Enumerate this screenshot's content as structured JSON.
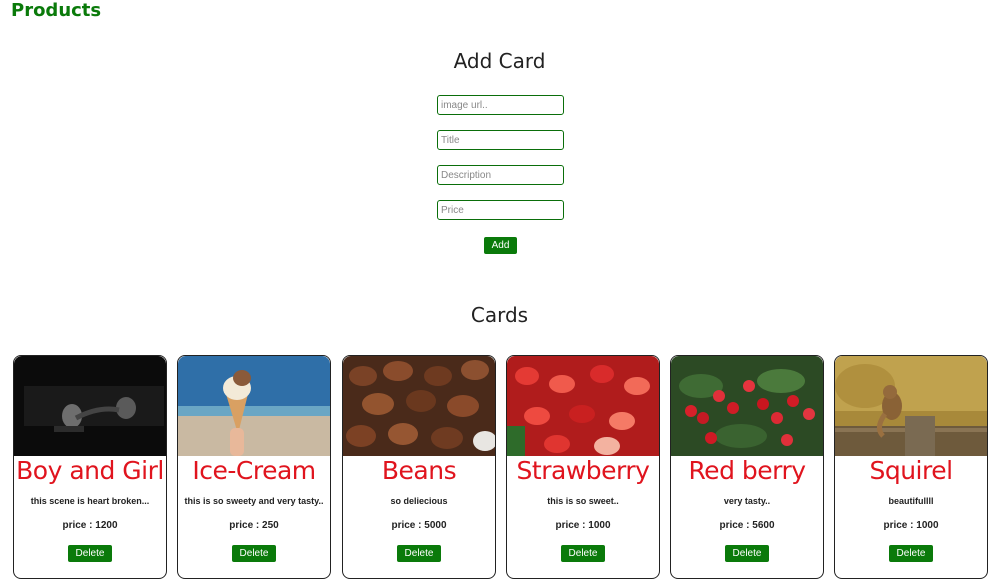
{
  "header": {
    "brand": "Products"
  },
  "add_card": {
    "title": "Add Card",
    "fields": {
      "image_url_placeholder": "image url..",
      "title_placeholder": "Title",
      "description_placeholder": "Description",
      "price_placeholder": "Price"
    },
    "add_label": "Add"
  },
  "cards_section": {
    "title": "Cards",
    "price_prefix": "price :",
    "delete_label": "Delete",
    "cards": [
      {
        "title": "Boy and Girl",
        "description": "this scene is heart broken...",
        "price": "1200"
      },
      {
        "title": "Ice-Cream",
        "description": "this is so sweety and very tasty..",
        "price": "250"
      },
      {
        "title": "Beans",
        "description": "so deliecious",
        "price": "5000"
      },
      {
        "title": "Strawberry",
        "description": "this is so sweet..",
        "price": "1000"
      },
      {
        "title": "Red berry",
        "description": "very tasty..",
        "price": "5600"
      },
      {
        "title": "Squirel",
        "description": "beautifullll",
        "price": "1000"
      }
    ]
  },
  "colors": {
    "accent": "#0a7a0a",
    "card_title": "#e0141e"
  }
}
